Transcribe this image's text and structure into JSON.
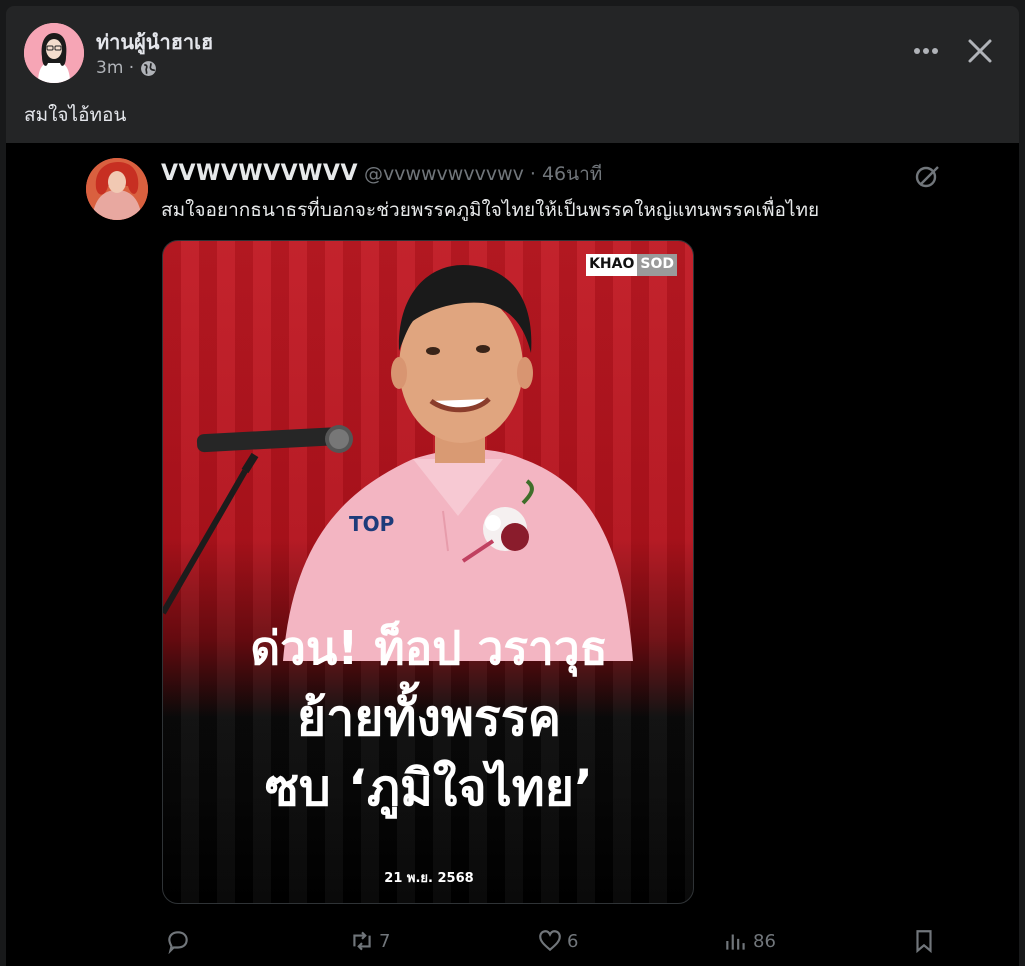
{
  "post": {
    "author": "ท่านผู้นำฮาเฮ",
    "time": "3m ·",
    "caption": "สมใจไอ้ทอน",
    "icons": {
      "more": "more-icon",
      "close": "close-icon",
      "privacy": "globe-icon"
    }
  },
  "tweet": {
    "display_name": "VVWVWVVWVV",
    "handle": "@vvwwvwvvvwv · 46นาที",
    "text": "สมใจอยากธนาธรที่บอกจะช่วยพรรคภูมิใจไทยให้เป็นพรรคใหญ่แทนพรรคเพื่อไทย",
    "news_card": {
      "logo_left": "KHAO",
      "logo_right": "SOD",
      "headline_1": "ด่วน! ท็อป วราวุธ",
      "headline_2": "ย้ายทั้งพรรค",
      "headline_3": "ซบ ‘ภูมิใจไทย’",
      "date": "21 พ.ย. 2568",
      "shirt_text": "TOP"
    },
    "actions": {
      "reply_count": "",
      "retweet_count": "7",
      "like_count": "6",
      "views_count": "86"
    }
  },
  "colors": {
    "background": "#242526",
    "media_background": "#000000",
    "news_red": "#c11a24",
    "muted": "#71767b"
  }
}
